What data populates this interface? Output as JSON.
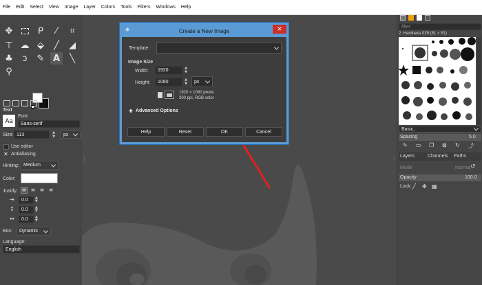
{
  "menubar": {
    "items": [
      "File",
      "Edit",
      "Select",
      "View",
      "Image",
      "Layer",
      "Colors",
      "Tools",
      "Filters",
      "Windows",
      "Help"
    ]
  },
  "tool_options": {
    "heading": "Text",
    "font_label": "Font",
    "font_preview": "Aa",
    "font_value": "Sans-serif",
    "size_label": "Size:",
    "size_value": "113",
    "size_unit": "px",
    "use_editor_label": "Use editor",
    "antialiasing_label": "Antialiasing",
    "hinting_label": "Hinting:",
    "hinting_value": "Medium",
    "color_label": "Color:",
    "justify_label": "Justify:",
    "indent_value": "0.0",
    "line_spacing_value": "0.0",
    "letter_spacing_value": "0.0",
    "box_label": "Box:",
    "box_value": "Dynamic",
    "language_label": "Language:",
    "language_value": "English"
  },
  "dialog": {
    "title": "Create a New Image",
    "close": "✕",
    "template_label": "Template:",
    "template_value": "",
    "image_size_heading": "Image Size",
    "width_label": "Width:",
    "width_value": "1920",
    "height_label": "Height:",
    "height_value": "1080",
    "unit_value": "px",
    "info_line1": "1920 × 1080 pixels",
    "info_line2": "300 ppi, RGB color",
    "advanced_label": "Advanced Options",
    "help_button": "Help",
    "reset_button": "Reset",
    "ok_button": "OK",
    "cancel_button": "Cancel"
  },
  "brushes": {
    "filter_placeholder": "filter",
    "brush_name": "2. Hardness 025 (51 × 51)",
    "tag_value": "Basic,",
    "spacing_label": "Spacing",
    "spacing_value": "5.0"
  },
  "layers": {
    "tabs": [
      "Layers",
      "Channels",
      "Paths"
    ],
    "mode_label": "Mode",
    "mode_value": "Normal",
    "opacity_label": "Opacity",
    "opacity_value": "100.0",
    "lock_label": "Lock:"
  },
  "colors": {
    "accent": "#5b9bd5",
    "arrow": "#e02020",
    "close": "#c9302c"
  }
}
